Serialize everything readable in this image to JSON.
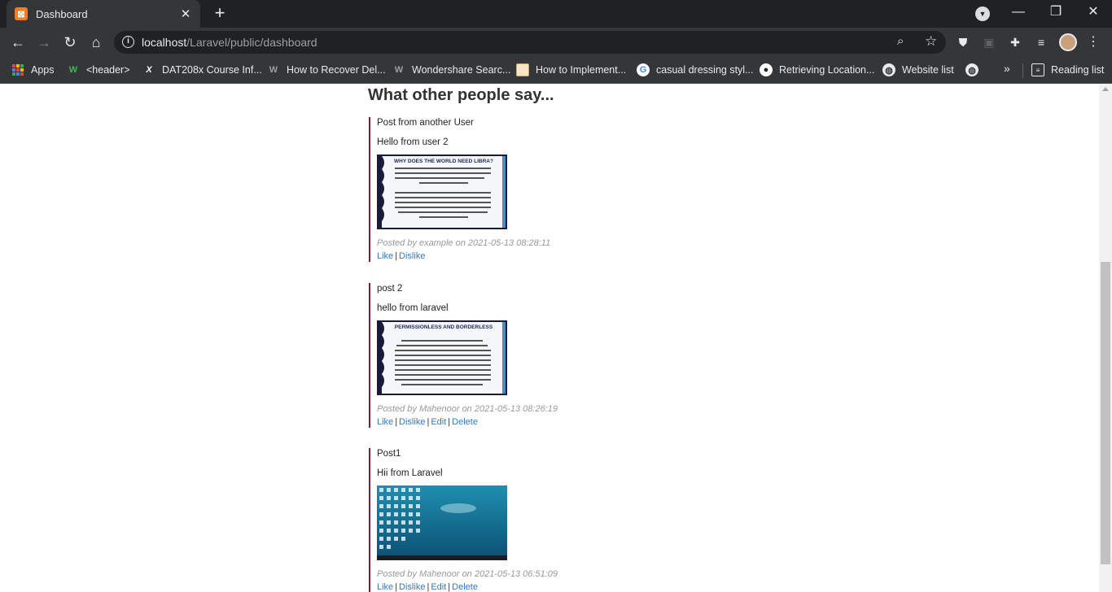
{
  "browser": {
    "tab_title": "Dashboard",
    "tab_favicon_letter": "⊠",
    "url_host": "localhost",
    "url_path": "/Laravel/public/dashboard",
    "bookmarks": [
      {
        "label": "Apps",
        "icon": "apps-grid-icon"
      },
      {
        "label": "<header>",
        "icon": "w-logo-icon"
      },
      {
        "label": "DAT208x Course Inf...",
        "icon": "x-logo-icon"
      },
      {
        "label": "How to Recover Del...",
        "icon": "w-logo-icon"
      },
      {
        "label": "Wondershare Searc...",
        "icon": "w-logo-icon"
      },
      {
        "label": "How to Implement...",
        "icon": "page-thumb-icon"
      },
      {
        "label": "casual dressing styl...",
        "icon": "google-icon"
      },
      {
        "label": "Retrieving Location...",
        "icon": "github-icon"
      },
      {
        "label": "Website list",
        "icon": "globe-icon"
      }
    ],
    "reading_list": "Reading list"
  },
  "page": {
    "heading": "What other people say...",
    "posts": [
      {
        "title": "Post from another User",
        "body": "Hello from user 2",
        "image_caption_title": "WHY DOES THE WORLD NEED LIBRA?",
        "info": "Posted by example on 2021-05-13 08:28:11",
        "actions": [
          "Like",
          "Dislike"
        ]
      },
      {
        "title": "post 2",
        "body": "hello from laravel",
        "image_caption_title": "PERMISSIONLESS AND BORDERLESS",
        "info": "Posted by Mahenoor on 2021-05-13 08:26:19",
        "actions": [
          "Like",
          "Dislike",
          "Edit",
          "Delete"
        ]
      },
      {
        "title": "Post1",
        "body": "Hii from Laravel",
        "image_caption_title": "",
        "info": "Posted by Mahenoor on 2021-05-13 06:51:09",
        "actions": [
          "Like",
          "Dislike",
          "Edit",
          "Delete"
        ]
      }
    ]
  },
  "colors": {
    "post_border": "#7b1f2e",
    "link": "#337ab7",
    "chrome_dark": "#202124",
    "chrome_toolbar": "#35363a"
  }
}
